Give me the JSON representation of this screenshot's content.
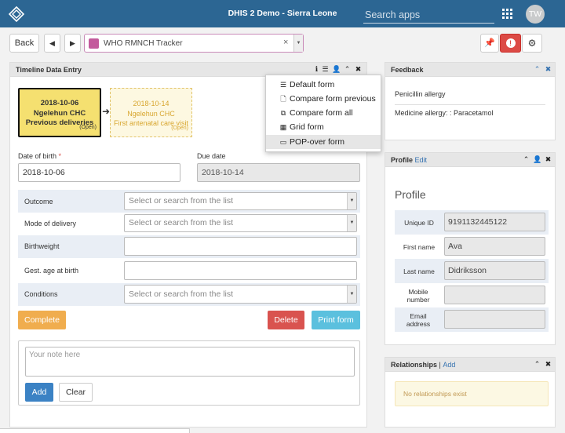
{
  "header": {
    "title": "DHIS 2 Demo - Sierra Leone",
    "search_placeholder": "Search apps",
    "avatar_initials": "TW",
    "bar_color": "#2c6693"
  },
  "toolbar": {
    "back_label": "Back",
    "program": "WHO RMNCH Tracker",
    "clear_symbol": "×"
  },
  "timeline": {
    "title": "Timeline Data Entry",
    "events": [
      {
        "date": "2018-10-06",
        "org_unit": "Ngelehun CHC",
        "stage": "Previous deliveries",
        "status": "(Open)"
      },
      {
        "date": "2018-10-14",
        "org_unit": "Ngelehun CHC",
        "stage": "First antenatal care visit",
        "status": "(Open)"
      }
    ],
    "date_of_birth_label": "Date of birth",
    "date_of_birth_value": "2018-10-06",
    "due_date_label": "Due date",
    "due_date_value": "2018-10-14",
    "fields": [
      {
        "label": "Outcome",
        "placeholder": "Select or search from the list"
      },
      {
        "label": "Mode of delivery",
        "placeholder": "Select or search from the list"
      },
      {
        "label": "Birthweight",
        "placeholder": ""
      },
      {
        "label": "Gest. age at birth",
        "placeholder": ""
      },
      {
        "label": "Conditions",
        "placeholder": "Select or search from the list"
      }
    ],
    "complete_label": "Complete",
    "delete_label": "Delete",
    "print_label": "Print form",
    "note_placeholder": "Your note here",
    "add_label": "Add",
    "clear_label": "Clear"
  },
  "layout_menu": {
    "items": [
      {
        "label": "Default form",
        "icon": "list-icon"
      },
      {
        "label": "Compare form previous",
        "icon": "file-icon"
      },
      {
        "label": "Compare form all",
        "icon": "copy-icon"
      },
      {
        "label": "Grid form",
        "icon": "grid-icon"
      },
      {
        "label": "POP-over form",
        "icon": "window-icon"
      }
    ]
  },
  "feedback": {
    "title": "Feedback",
    "items": [
      "Penicillin allergy",
      "Medicine allergy: : Paracetamol"
    ]
  },
  "profile": {
    "title": "Profile",
    "edit_label": "Edit",
    "heading": "Profile",
    "rows": [
      {
        "label": "Unique ID",
        "value": "9191132445122"
      },
      {
        "label": "First name",
        "value": "Ava"
      },
      {
        "label": "Last name",
        "value": "Didriksson"
      },
      {
        "label": "Mobile number",
        "value": ""
      },
      {
        "label": "Email address",
        "value": ""
      }
    ]
  },
  "relationships": {
    "title": "Relationships",
    "add_label": "Add",
    "empty_text": "No relationships exist"
  }
}
